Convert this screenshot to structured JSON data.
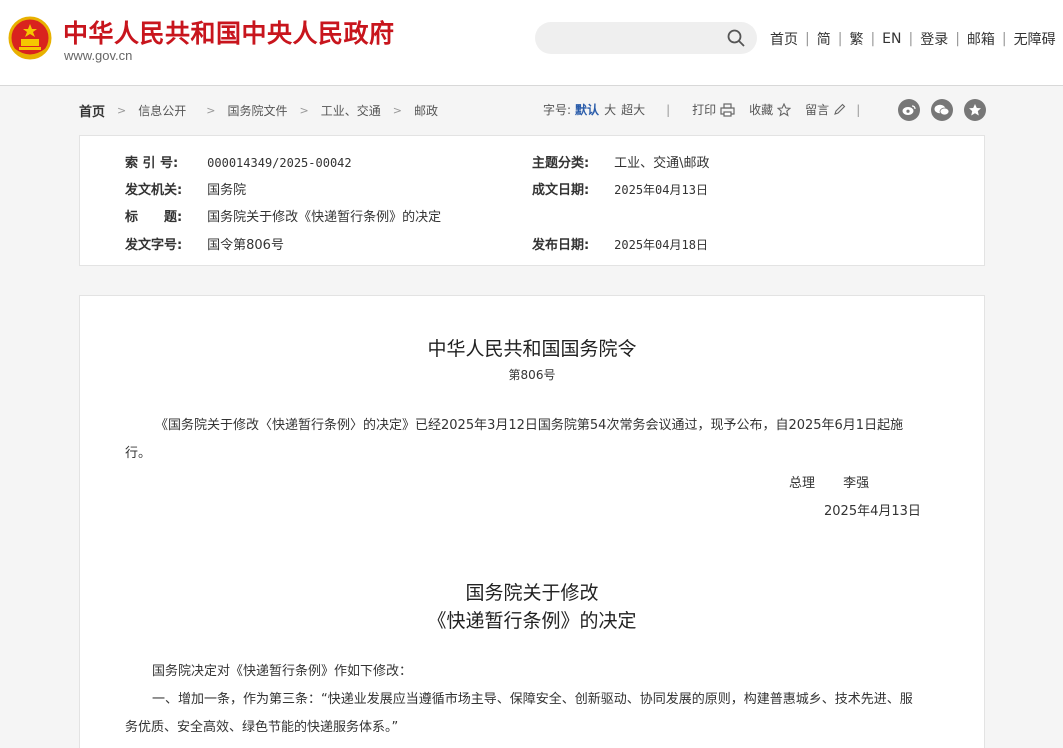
{
  "header": {
    "site_title": "中华人民共和国中央人民政府",
    "site_url": "www.gov.cn",
    "search": {
      "value": "",
      "placeholder": ""
    },
    "nav": [
      "首页",
      "简",
      "繁",
      "EN",
      "登录",
      "邮箱",
      "无障碍"
    ]
  },
  "breadcrumb": [
    "首页",
    "信息公开",
    "国务院文件",
    "工业、交通",
    "邮政"
  ],
  "tools": {
    "font_label": "字号:",
    "font_sizes": [
      "默认",
      "大",
      "超大"
    ],
    "print": "打印",
    "favorite": "收藏",
    "comment": "留言"
  },
  "info": {
    "index_label": "索 引 号:",
    "index_value": "000014349/2025-00042",
    "category_label": "主题分类:",
    "category_value": "工业、交通\\邮政",
    "issuer_label": "发文机关:",
    "issuer_value": "国务院",
    "written_label": "成文日期:",
    "written_value": "2025年04月13日",
    "title_label": "标　　题:",
    "title_value": "国务院关于修改《快递暂行条例》的决定",
    "docno_label": "发文字号:",
    "docno_value": "国令第806号",
    "published_label": "发布日期:",
    "published_value": "2025年04月18日"
  },
  "article": {
    "order_title": "中华人民共和国国务院令",
    "order_no": "第806号",
    "intro": "《国务院关于修改〈快递暂行条例〉的决定》已经2025年3月12日国务院第54次常务会议通过，现予公布，自2025年6月1日起施行。",
    "signer_role": "总理",
    "signer_name": "李强",
    "sign_date": "2025年4月13日",
    "decision_title_1": "国务院关于修改",
    "decision_title_2": "《快递暂行条例》的决定",
    "p1": "国务院决定对《快递暂行条例》作如下修改：",
    "p2": "一、增加一条，作为第三条：“快递业发展应当遵循市场主导、保障安全、创新驱动、协同发展的原则，构建普惠城乡、技术先进、服务优质、安全高效、绿色节能的快递服务体系。”"
  }
}
